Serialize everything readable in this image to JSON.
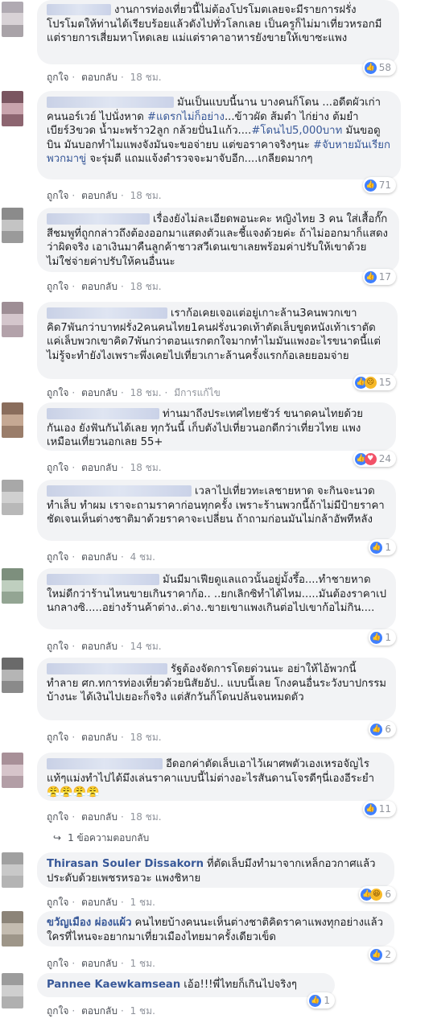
{
  "actions": {
    "like": "ถูกใจ",
    "reply": "ตอบกลับ",
    "edited": "มีการแก้ไข"
  },
  "comments": [
    {
      "text": "งานการท่องเที่ยวนี้ไม่ต้องโปรโมตเลยจะมีรายการฝรั่งโปรโมตให้ท่านได้เรียบร้อยแล้วดังไปทั่วโลกเลย เป็นครูก็ไม่มาเที่ยวหรอกมีแต่รายการเสี่ยมหาโหดเลย แม่แต่ราคาอาหารยังขายให้เขาซะแพง",
      "time": "18 ชม.",
      "count": "58"
    },
    {
      "text_a": "มันเป็นแบบนี้นาน บางคนก็โดน ...อดีตผัวเก่าคนนอร์เวย์ ไปนั่งหาด ",
      "tag1": "#แดรกไม่ก็อย่าง",
      "text_b": "...ข้าวผัด ส้มตำ ไก่ย่าง ต้มยำ เบียร์3ขวด น้ำมะพร้าว2ลูก กล้วยปั่น1แก้ว....",
      "tag2": "#โดนไป5,000บาท",
      "text_c": " มันขอดูบิน มันบอกทำไมแพงจังมันจะขอจ่ายบ แต่ขอราคาจริงๆนะ ",
      "tag3": "#จับหายมันเรียกพวกมาขู่",
      "text_d": " จะรุ่มตี แถมแจ้งตำรวจจะมาจับอีก....เกลียดมากๆ",
      "time": "18 ชม.",
      "count": "71"
    },
    {
      "text": "เรื่องยังไม่ละเอียดพอนะคะ หญิงไทย 3 คน ใส่เสื้อกั๊กสีชมพูที่ถูกกล่าวถึงต้องออกมาแสดงตัวและชี้แจงด้วยค่ะ ถ้าไม่ออกมาก็แสดงว่าผิดจริง เอาเงินมาคืนลูกค้าชาวสวีเดนเขาเลยพร้อมค่าปรับให้เขาด้วย ไม่ใช่จ่ายค่าปรับให้คนอื่นนะ",
      "time": "18 ชม.",
      "count": "17"
    },
    {
      "text": "เราก้อเคยเจอแต่อยู่เกาะล้าน3คนพวกเขาคิด7พันกว่าบาทฝรั่ง2คนคนไทย1คนฝรั่งนวดเท้าตัดเล็บขูดหนังเท้าเราตัดแค่เล็บพวกเขาคิด7พันกว่าตอนแรกตกใจมากทำไมมันแพงอะไรขนาดนี้แต่ไม่รู้จะทำยังไงเพราะพึ่งเคยไปเที่ยวเกาะล้านครั้งแรกก้อเลยยอมจ่าย",
      "time": "18 ชม.",
      "count": "15"
    },
    {
      "text": "ท่านมาถึงประเทศไทยชัวร์ ขนาดคนไทยด้วยกันเอง ยังฟันกันได้เลย ทุกวันนี้ เก็บตังไปเที่ยวนอกดีกว่าเที่ยวไทย แพงเหมือนเที่ยวนอกเลย 55+",
      "time": "18 ชม.",
      "count": "24"
    },
    {
      "text": "เวลาไปเที่ยวทะเลชายหาด จะกินจะนวด ทำเล็บ ทำผม เราจะถามราคาก่อนทุกครั้ง เพราะร้านพวกนี้ถ้าไม่มีป้ายราคาชัดเจนเห็นต่างชาติมาด้วยราคาจะเปลี่ยน ถ้าถามก่อนมันไม่กล้าอัพทีหลัง",
      "time": "4 ชม.",
      "count": "1"
    },
    {
      "text": "มันมีมาเฟียดูแลแถวนั้นอยู่มั้งรึ้อ....ทำชายหาดใหม่ดีกว่าร้านไหนขายเกินราคาก้อ.. ..ยกเลิกซิทำได้ไหม.....มันต้องราคาเปนกลางซิ.....อย่างร้านค้าต่าง..ต่าง..ขายเขาแพงเกินต่อไปเขาก้อไม่กิน....",
      "time": "14 ชม.",
      "count": "1"
    },
    {
      "text": "รัฐต้องจัดการโดยด่วนนะ อย่าให้ไอ้พวกนี้ทำลาย ศก.ทการท่องเที่ยวด้วยนิสัยอัป.. แบบนี้เลย โกงคนอื่นระวังบาปกรรมบ้างนะ ได้เงินไปเยอะก็จริง แต่สักวันก็โดนปล้นจนหมดตัว",
      "time": "18 ชม.",
      "count": "6"
    },
    {
      "text": "อีดอกค่าตัดเล็บเอาไว้เผาศพตัวเองเหรอจัญไรแท้ๆแม่งทำไปได้มึงเล่นราคาแบบนี้ไม่ต่างอะไรสันดานโจรดีๆนี่เองอีระยำ😤😤😤😤",
      "time": "18 ชม.",
      "count": "11",
      "more": "1 ข้อความตอบกลับ"
    },
    {
      "name": "Thirasan Souler Dissakorn",
      "text": "ที่ตัดเล็บมึงทำมาจากเหล็กอวกาศแล้วประดับด้วยเพชรหรอวะ แพงชิหาย",
      "time": "1 ชม.",
      "count": "6"
    },
    {
      "name": "ขวัญเมือง ผ่องแผ้ว",
      "text": "คนไทยบ้างคนนะเห็นต่างชาติคิดราคาแพงทุกอย่างแล้วใครที่ไหนจะอยากมาเที่ยวเมืองไทยมาครั้งเดียวเข็ด",
      "time": "1 ชม.",
      "count": "2"
    },
    {
      "name": "Pannee Kaewkamsean",
      "text": "เอ้อ!!!พี่ไทยก็เกินไปจริงๆ",
      "time": "1 ชม.",
      "count": "1"
    }
  ],
  "colors": {
    "bubble": "#f2f3f5",
    "link": "#385898",
    "meta": "#90949c",
    "like": "#4080ff"
  }
}
